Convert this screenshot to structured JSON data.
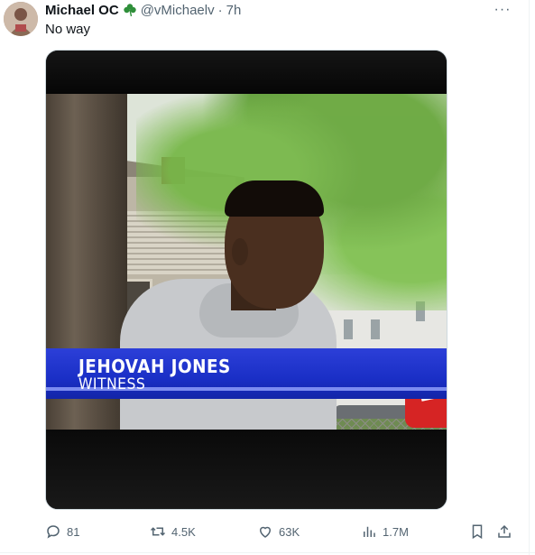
{
  "tweet": {
    "display_name": "Michael OC",
    "badge_icon": "shamrock-icon",
    "handle": "@vMichaelv",
    "separator": "·",
    "timestamp": "7h",
    "more_label": "···",
    "text": "No way"
  },
  "media": {
    "lower_third_name": "JEHOVAH JONES",
    "lower_third_title": "WITNESS",
    "station_logo": "19",
    "colors": {
      "banner": "#1a2fc6",
      "mic_flag": "#d62424"
    }
  },
  "actions": {
    "replies": "81",
    "retweets": "4.5K",
    "likes": "63K",
    "views": "1.7M",
    "icons": [
      "reply-icon",
      "retweet-icon",
      "like-icon",
      "views-icon",
      "bookmark-icon",
      "share-icon"
    ]
  }
}
